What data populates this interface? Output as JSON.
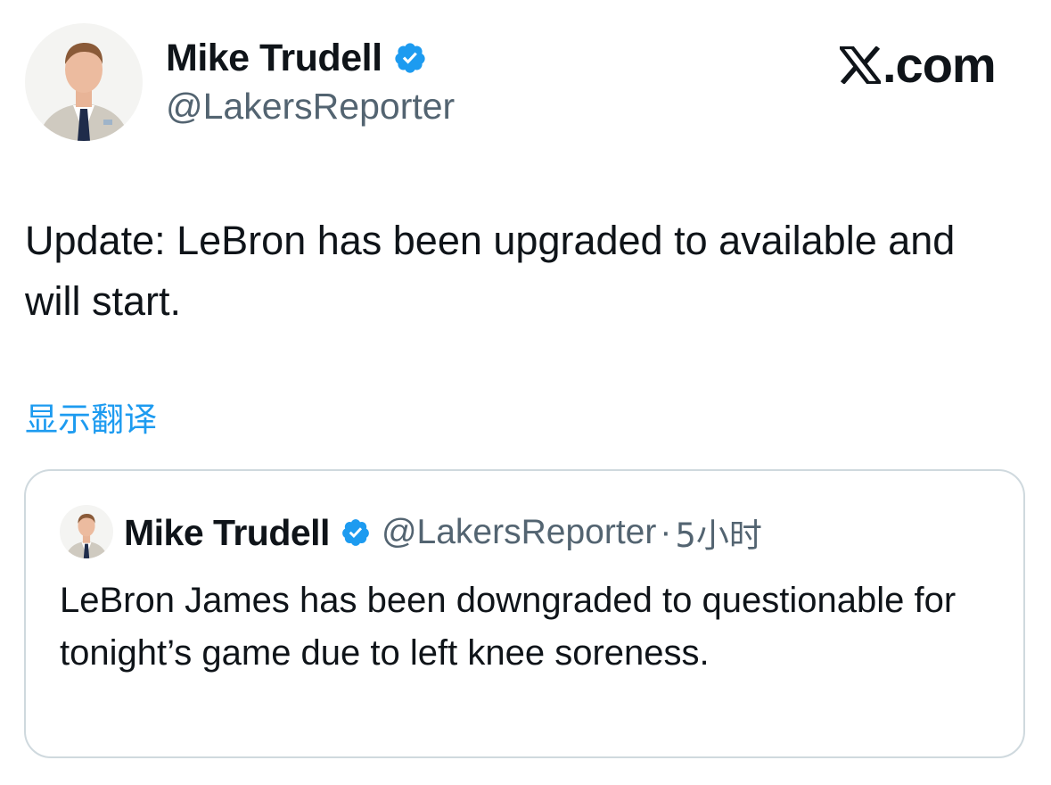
{
  "brand": {
    "icon": "x-logo-icon",
    "text": ".com"
  },
  "author": {
    "name": "Mike Trudell",
    "handle": "@LakersReporter",
    "verified_icon": "verified-badge-icon",
    "verified_color": "#1d9bf0"
  },
  "tweet": {
    "text": "Update: LeBron has been upgraded to available and will start."
  },
  "translate": {
    "label": "显示翻译",
    "color": "#1d9bf0"
  },
  "quoted_tweet": {
    "name": "Mike Trudell",
    "handle": "@LakersReporter",
    "separator": "·",
    "time": "5小时",
    "text": "LeBron James has been downgraded to questionable for tonight’s game due to left knee soreness."
  }
}
